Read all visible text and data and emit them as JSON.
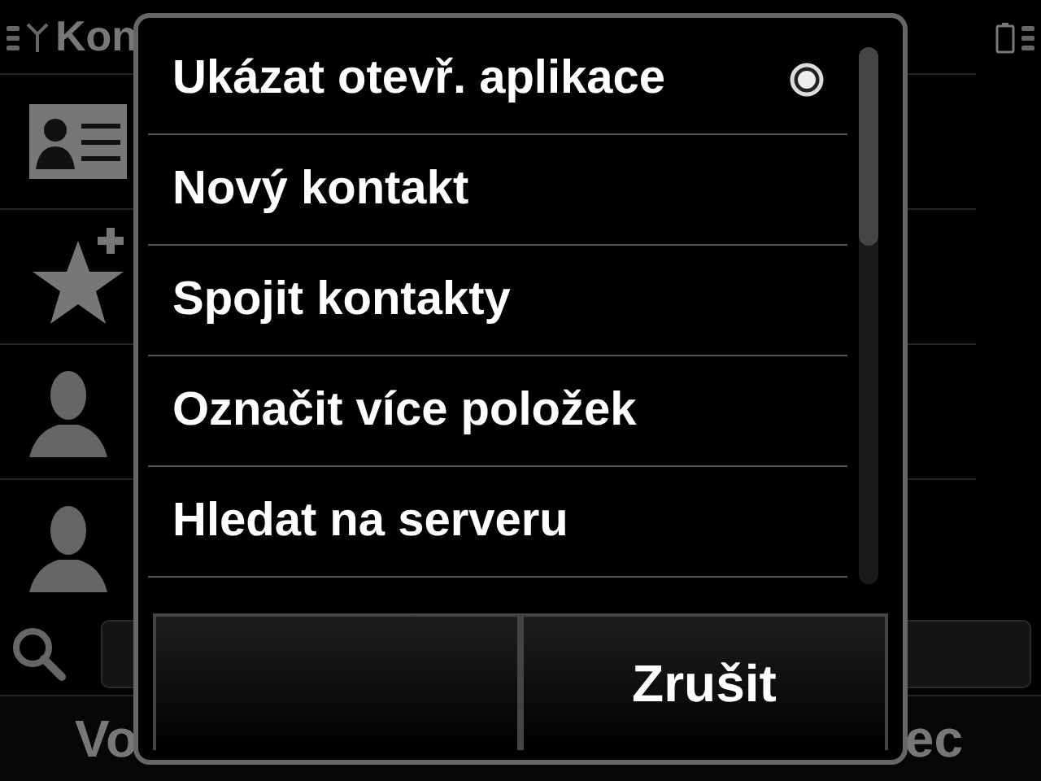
{
  "background": {
    "title": "Kon",
    "softkeys": [
      "Vo",
      "ec"
    ]
  },
  "menu": {
    "items": [
      {
        "label": "Ukázat otevř. aplikace",
        "kind": "radio",
        "checked": true
      },
      {
        "label": "Nový kontakt",
        "kind": "plain"
      },
      {
        "label": "Spojit kontakty",
        "kind": "plain"
      },
      {
        "label": "Označit více položek",
        "kind": "plain"
      },
      {
        "label": "Hledat na serveru",
        "kind": "plain"
      }
    ],
    "buttons": [
      {
        "kind": "blank"
      },
      {
        "kind": "text",
        "label": "Zrušit"
      }
    ]
  }
}
